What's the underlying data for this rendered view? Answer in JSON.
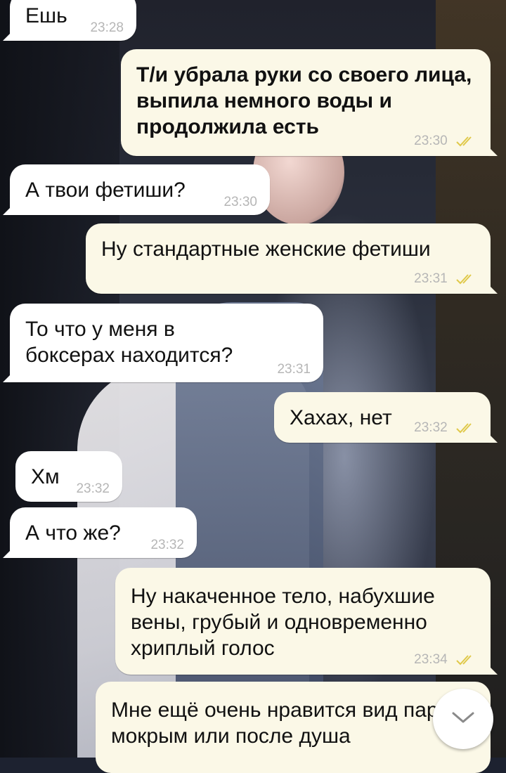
{
  "messages": [
    {
      "text": "Ешь",
      "time": "23:28",
      "side": "in"
    },
    {
      "text": "Т/и убрала руки со своего лица, выпила немного воды и продолжила есть",
      "time": "23:30",
      "side": "out",
      "bold": true
    },
    {
      "text": "А твои фетиши?",
      "time": "23:30",
      "side": "in"
    },
    {
      "text": "Ну стандартные женские фетиши",
      "time": "23:31",
      "side": "out"
    },
    {
      "text": "То что у меня в боксерах находится?",
      "time": "23:31",
      "side": "in"
    },
    {
      "text": "Хахах, нет",
      "time": "23:32",
      "side": "out"
    },
    {
      "text": "Хм",
      "time": "23:32",
      "side": "in"
    },
    {
      "text": "А что же?",
      "time": "23:32",
      "side": "in"
    },
    {
      "text": "Ну накаченное тело, набухшие вены, грубый и одновременно хриплый голос",
      "time": "23:34",
      "side": "out"
    },
    {
      "text": "Мне ещё очень нравится вид парня мокрым или после душа",
      "time": "",
      "side": "out"
    }
  ],
  "colors": {
    "incoming": "#ffffff",
    "outgoing": "#fbf8e7",
    "read_checks": "#e0c94a",
    "time": "#b6b6b6"
  },
  "icons": {
    "read_receipt": "double-check-icon",
    "scroll_down": "chevron-down-icon"
  }
}
